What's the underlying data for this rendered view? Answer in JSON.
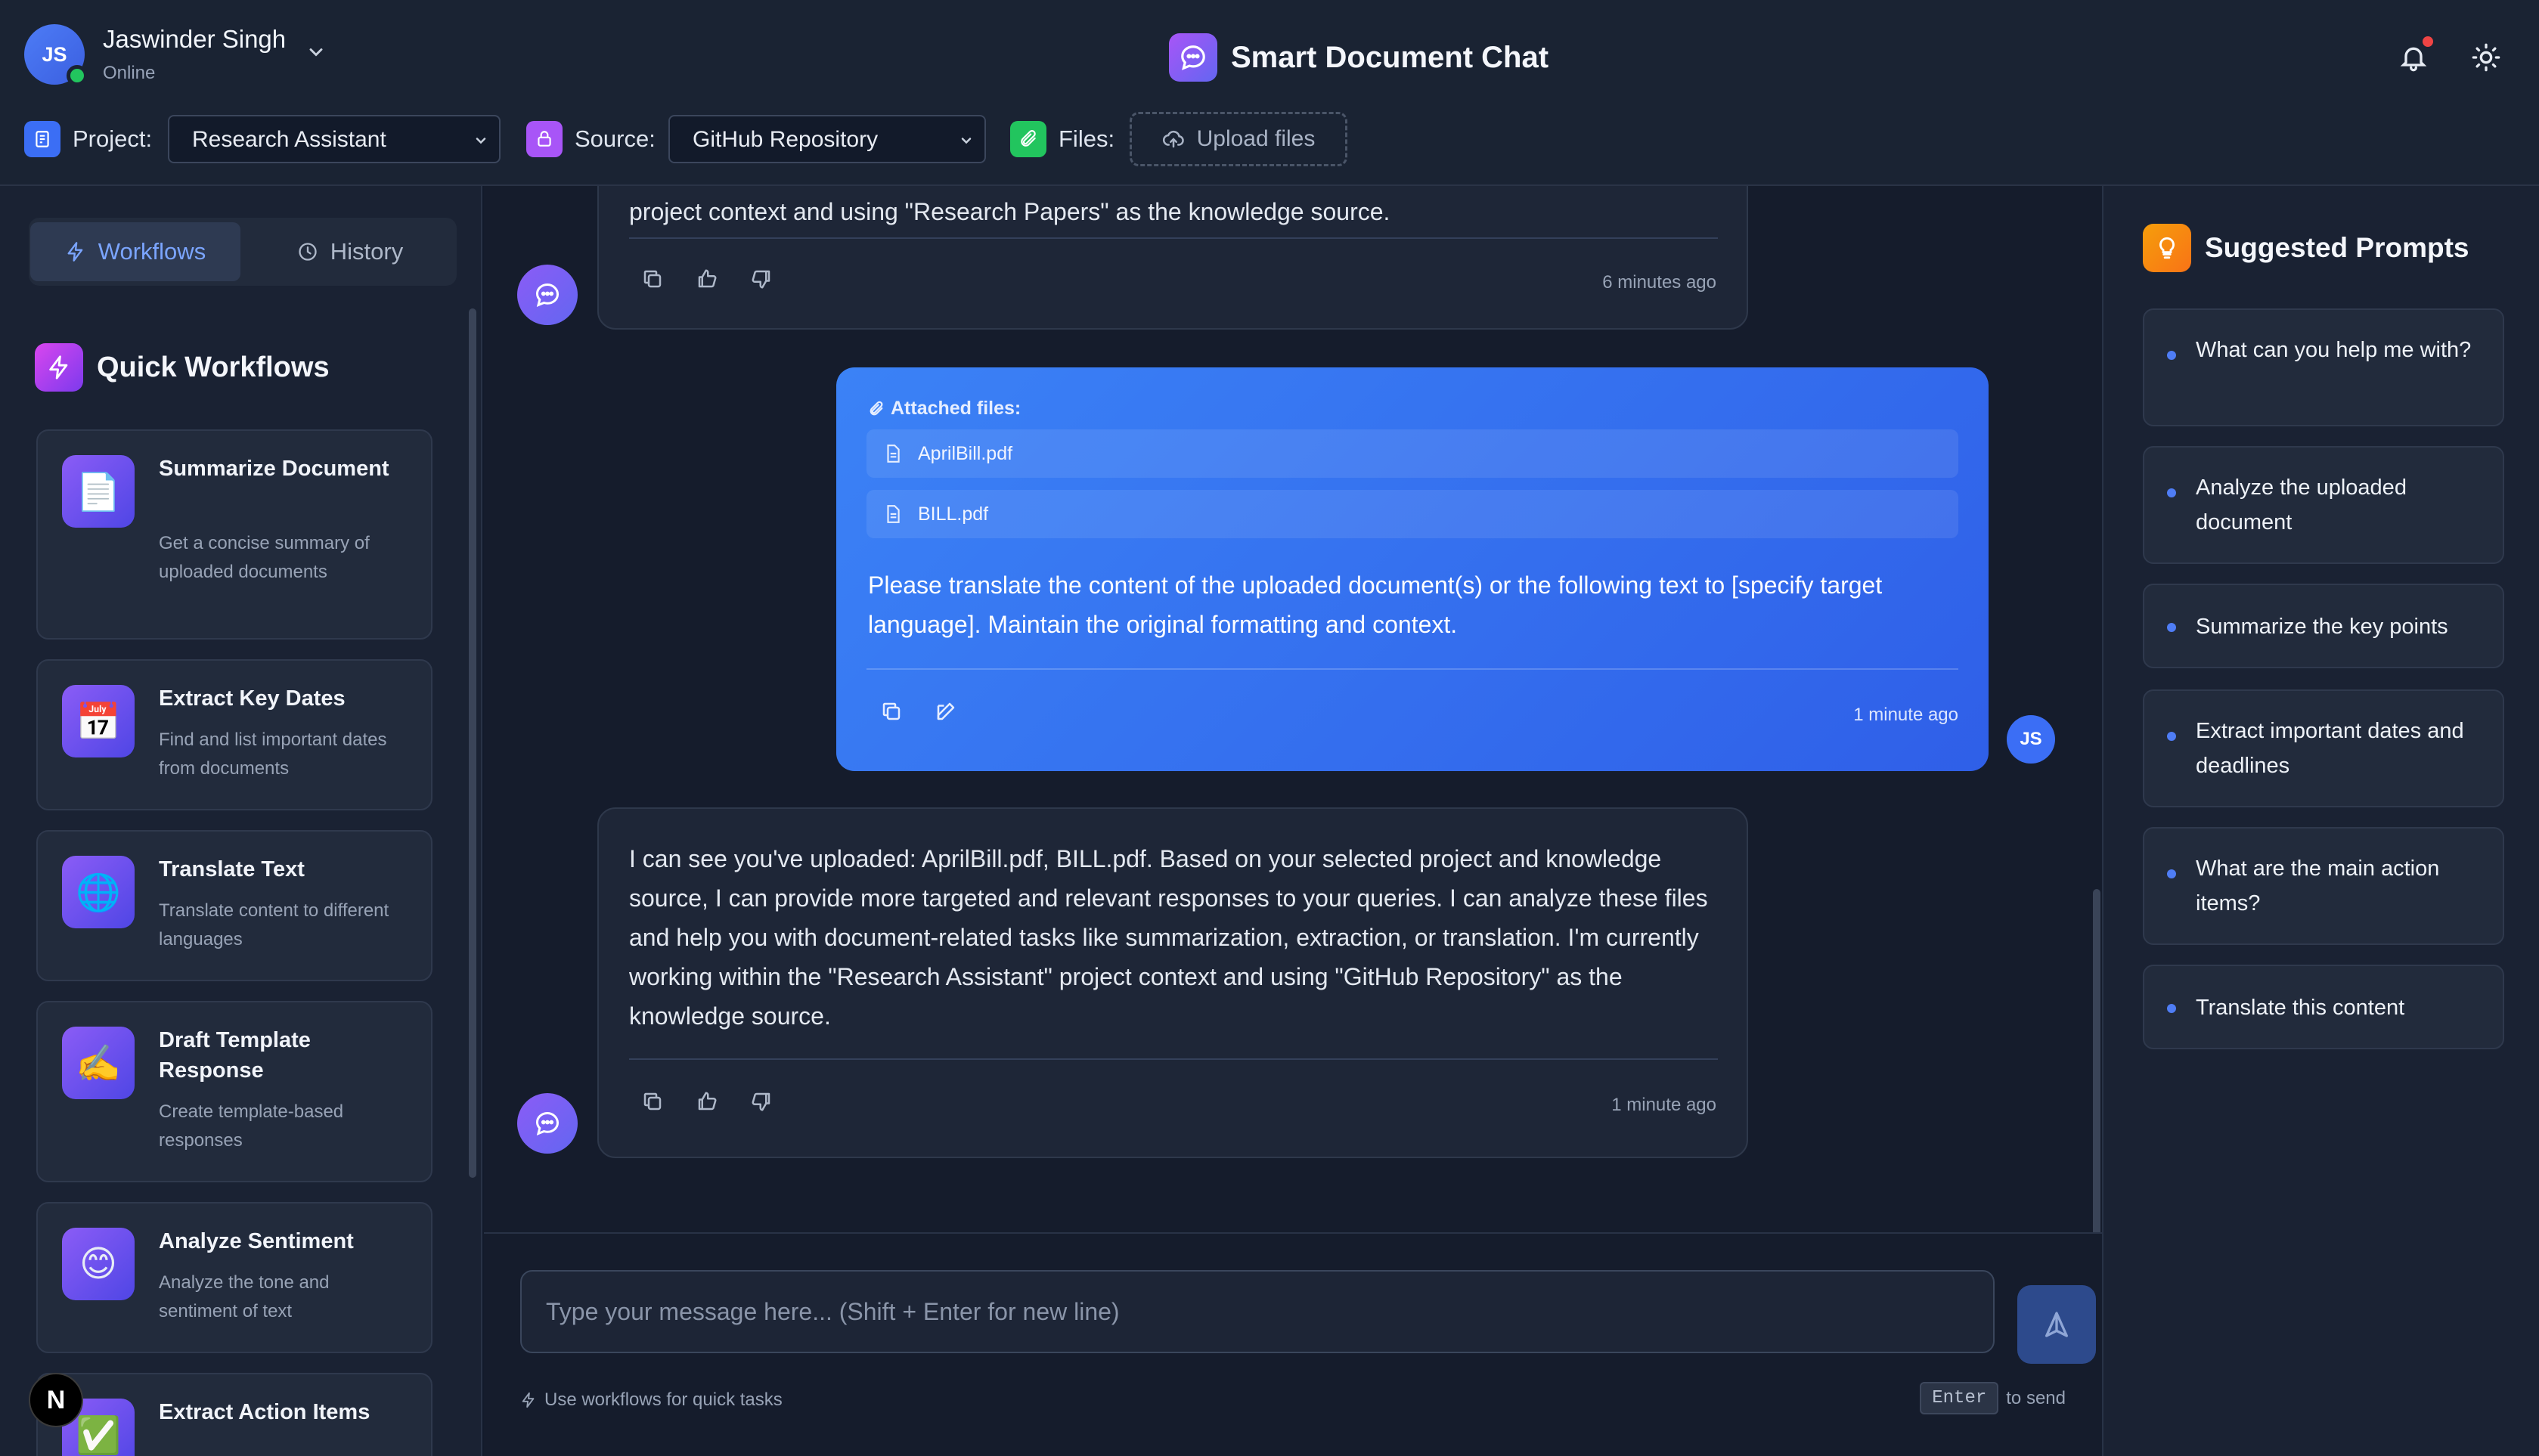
{
  "header": {
    "user": {
      "initials": "JS",
      "name": "Jaswinder Singh",
      "status": "Online"
    },
    "app_title": "Smart Document Chat",
    "project": {
      "label": "Project:",
      "value": "Research Assistant"
    },
    "source": {
      "label": "Source:",
      "value": "GitHub Repository"
    },
    "files": {
      "label": "Files:",
      "upload_label": "Upload files"
    }
  },
  "sidebar": {
    "tabs": [
      {
        "label": "Workflows",
        "active": true
      },
      {
        "label": "History",
        "active": false
      }
    ],
    "section_title": "Quick Workflows",
    "workflows": [
      {
        "icon": "document-icon",
        "glyph": "📄",
        "title": "Summarize Document",
        "desc": "Get a concise summary of uploaded documents"
      },
      {
        "icon": "calendar-icon",
        "glyph": "📅",
        "title": "Extract Key Dates",
        "desc": "Find and list important dates from documents"
      },
      {
        "icon": "globe-icon",
        "glyph": "🌐",
        "title": "Translate Text",
        "desc": "Translate content to different languages"
      },
      {
        "icon": "writing-hand-icon",
        "glyph": "✍️",
        "title": "Draft Template Response",
        "desc": "Create template-based responses"
      },
      {
        "icon": "smiley-icon",
        "glyph": "😊",
        "title": "Analyze Sentiment",
        "desc": "Analyze the tone and sentiment of text"
      },
      {
        "icon": "check-box-icon",
        "glyph": "✅",
        "title": "Extract Action Items",
        "desc": ""
      }
    ],
    "badge": "N"
  },
  "chat": {
    "messages": [
      {
        "role": "assistant",
        "text_fragment": "project context and using \"Research Papers\" as the knowledge source.",
        "time": "6 minutes ago"
      },
      {
        "role": "user",
        "attached_label": "Attached files:",
        "files": [
          "AprilBill.pdf",
          "BILL.pdf"
        ],
        "text": "Please translate the content of the uploaded document(s) or the following text to [specify target language]. Maintain the original formatting and context.",
        "time": "1 minute ago",
        "avatar": "JS"
      },
      {
        "role": "assistant",
        "text": "I can see you've uploaded: AprilBill.pdf, BILL.pdf. Based on your selected project and knowledge source, I can provide more targeted and relevant responses to your queries. I can analyze these files and help you with document-related tasks like summarization, extraction, or translation. I'm currently working within the \"Research Assistant\" project context and using \"GitHub Repository\" as the knowledge source.",
        "time": "1 minute ago"
      }
    ],
    "input": {
      "placeholder": "Type your message here... (Shift + Enter for new line)",
      "value": ""
    },
    "hint": "Use workflows for quick tasks",
    "enter_key": "Enter",
    "enter_hint": "to send"
  },
  "suggested": {
    "title": "Suggested Prompts",
    "prompts": [
      "What can you help me with?",
      "Analyze the uploaded document",
      "Summarize the key points",
      "Extract important dates and deadlines",
      "What are the main action items?",
      "Translate this content"
    ]
  },
  "colors": {
    "accent": "#3b82f6",
    "background": "#121a2b",
    "panel": "#1a2233",
    "online": "#22c55e",
    "notification": "#ef4444"
  }
}
